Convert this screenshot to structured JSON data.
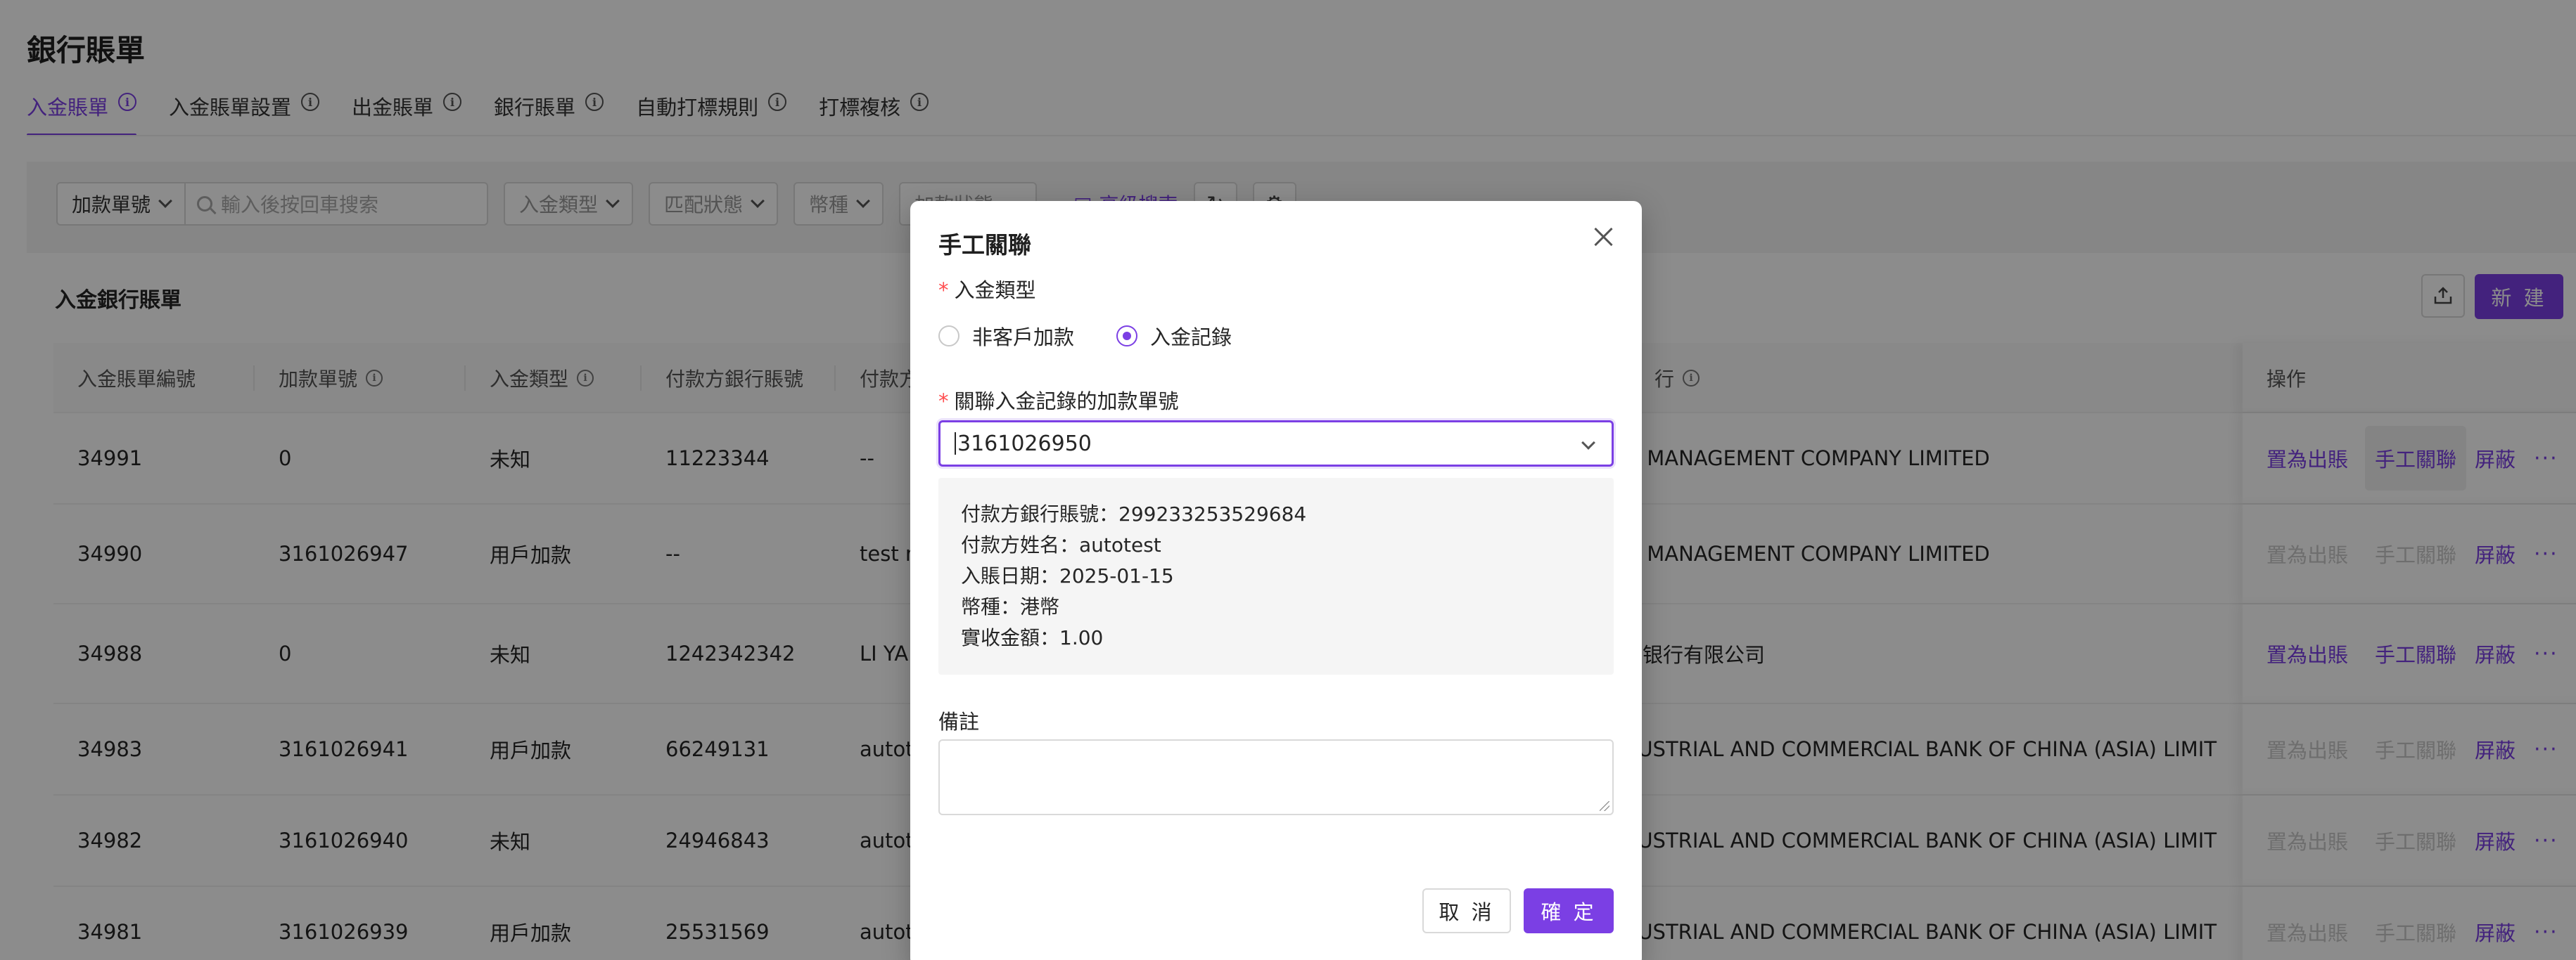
{
  "page": {
    "title": "銀行賬單",
    "tabs": [
      {
        "label": "入金賬單",
        "active": true
      },
      {
        "label": "入金賬單設置"
      },
      {
        "label": "出金賬單"
      },
      {
        "label": "銀行賬單"
      },
      {
        "label": "自動打標規則"
      },
      {
        "label": "打標複核"
      }
    ]
  },
  "filters": {
    "order_field": "加款單號",
    "search_placeholder": "輸入後按回車搜索",
    "deposit_type": "入金類型",
    "match_status": "匹配狀態",
    "currency": "幣種",
    "add_status": "加款狀態",
    "advanced": "高級搜索"
  },
  "card": {
    "title": "入金銀行賬單",
    "new_label": "新 建"
  },
  "table": {
    "columns": [
      "入金賬單編號",
      "加款單號",
      "入金類型",
      "付款方銀行賬號",
      "付款方姓名",
      "行",
      "操作"
    ],
    "rows": [
      {
        "id": "34991",
        "order": "0",
        "type": "未知",
        "account": "11223344",
        "name": "--",
        "bank": "PI MANAGEMENT COMPANY LIMITED",
        "a1": "置為出賬",
        "a2": "手工關聯",
        "a3": "屏蔽",
        "a1_disabled": false,
        "a2_disabled": false
      },
      {
        "id": "34990",
        "order": "3161026947",
        "type": "用戶加款",
        "account": "--",
        "name": "test nam",
        "bank": "PI MANAGEMENT COMPANY LIMITED",
        "a1": "置為出賬",
        "a2": "手工關聯",
        "a3": "屏蔽",
        "a1_disabled": true,
        "a2_disabled": true
      },
      {
        "id": "34988",
        "order": "0",
        "type": "未知",
        "account": "1242342342",
        "name": "LI YANG",
        "bank": "兴银行有限公司",
        "a1": "置為出賬",
        "a2": "手工關聯",
        "a3": "屏蔽",
        "a1_disabled": false,
        "a2_disabled": false
      },
      {
        "id": "34983",
        "order": "3161026941",
        "type": "用戶加款",
        "account": "66249131",
        "name": "autotest",
        "bank": "DUSTRIAL AND COMMERCIAL BANK OF CHINA (ASIA) LIMIT",
        "a1": "置為出賬",
        "a2": "手工關聯",
        "a3": "屏蔽",
        "a1_disabled": true,
        "a2_disabled": true
      },
      {
        "id": "34982",
        "order": "3161026940",
        "type": "未知",
        "account": "24946843",
        "name": "autotest",
        "bank": "DUSTRIAL AND COMMERCIAL BANK OF CHINA (ASIA) LIMIT",
        "a1": "置為出賬",
        "a2": "手工關聯",
        "a3": "屏蔽",
        "a1_disabled": true,
        "a2_disabled": true
      },
      {
        "id": "34981",
        "order": "3161026939",
        "type": "用戶加款",
        "account": "25531569",
        "name": "autotest",
        "bank": "DUSTRIAL AND COMMERCIAL BANK OF CHINA (ASIA) LIMIT",
        "a1": "置為出賬",
        "a2": "手工關聯",
        "a3": "屏蔽",
        "a1_disabled": true,
        "a2_disabled": true
      }
    ]
  },
  "modal": {
    "title": "手工關聯",
    "type_label": "入金類型",
    "option_non_customer": "非客戶加款",
    "option_deposit_record": "入金記錄",
    "selected_option": "入金記錄",
    "link_label": "關聯入金記錄的加款單號",
    "link_value": "3161026950",
    "details": [
      "付款方銀行賬號：299233253529684",
      "付款方姓名：autotest",
      "入賬日期：2025-01-15",
      "幣種：港幣",
      "實收金額：1.00"
    ],
    "remark_label": "備註",
    "remark_value": "",
    "cancel_label": "取 消",
    "confirm_label": "確 定"
  },
  "colors": {
    "accent": "#7b3fe4",
    "required": "#ff4d4f"
  }
}
